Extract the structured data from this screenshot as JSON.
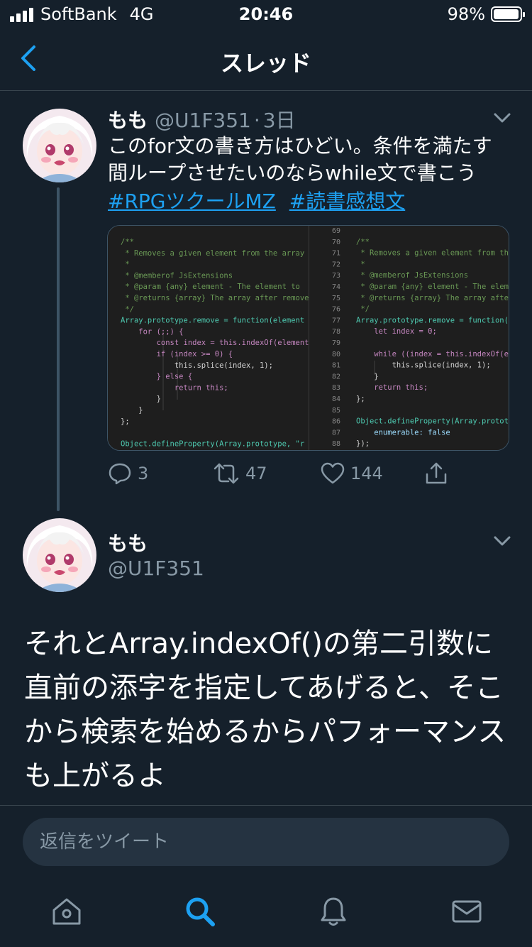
{
  "status_bar": {
    "carrier": "SoftBank",
    "network": "4G",
    "time": "20:46",
    "battery": "98%",
    "battery_level": 0.98
  },
  "nav": {
    "title": "スレッド",
    "back_icon": "chevron-left-icon"
  },
  "tweet1": {
    "name": "もも",
    "handle": "@U1F351",
    "dot": "·",
    "time": "3日",
    "text": "このfor文の書き方はひどい。条件を満たす間ループさせたいのならwhile文で書こう",
    "hashtags": [
      "#RPGツクールMZ",
      "#読書感想文"
    ],
    "replies": "3",
    "retweets": "47",
    "likes": "144"
  },
  "code_left": [
    {
      "ln": "",
      "text": "/**"
    },
    {
      "ln": "",
      "text": " * Removes a given element from the array"
    },
    {
      "ln": "",
      "text": " *"
    },
    {
      "ln": "",
      "text": " * @memberof JsExtensions"
    },
    {
      "ln": "",
      "text": " * @param {any} element - The element to"
    },
    {
      "ln": "",
      "text": " * @returns {array} The array after remove"
    },
    {
      "ln": "",
      "text": " */"
    },
    {
      "ln": "",
      "text": "Array.prototype.remove = function(element"
    },
    {
      "ln": "",
      "text": "    for (;;) {"
    },
    {
      "ln": "",
      "text": "        const index = this.indexOf(element"
    },
    {
      "ln": "",
      "text": "        if (index >= 0) {"
    },
    {
      "ln": "",
      "text": "            this.splice(index, 1);"
    },
    {
      "ln": "",
      "text": "        } else {"
    },
    {
      "ln": "",
      "text": "            return this;"
    },
    {
      "ln": "",
      "text": "        }"
    },
    {
      "ln": "",
      "text": "    }"
    },
    {
      "ln": "",
      "text": "};"
    },
    {
      "ln": "",
      "text": ""
    },
    {
      "ln": "",
      "text": "Object.defineProperty(Array.prototype, \"r"
    }
  ],
  "code_right": [
    {
      "ln": "69",
      "text": ""
    },
    {
      "ln": "70",
      "text": "/**"
    },
    {
      "ln": "71",
      "text": " * Removes a given element from th"
    },
    {
      "ln": "72",
      "text": " *"
    },
    {
      "ln": "73",
      "text": " * @memberof JsExtensions"
    },
    {
      "ln": "74",
      "text": " * @param {any} element - The elem"
    },
    {
      "ln": "75",
      "text": " * @returns {array} The array afte"
    },
    {
      "ln": "76",
      "text": " */"
    },
    {
      "ln": "77",
      "text": "Array.prototype.remove = function("
    },
    {
      "ln": "78",
      "text": "    let index = 0;"
    },
    {
      "ln": "79",
      "text": ""
    },
    {
      "ln": "80",
      "text": "    while ((index = this.indexOf(e"
    },
    {
      "ln": "81",
      "text": "        this.splice(index, 1);"
    },
    {
      "ln": "82",
      "text": "    }"
    },
    {
      "ln": "83",
      "text": "    return this;"
    },
    {
      "ln": "84",
      "text": "};"
    },
    {
      "ln": "85",
      "text": ""
    },
    {
      "ln": "86",
      "text": "Object.defineProperty(Array.protot"
    },
    {
      "ln": "87",
      "text": "    enumerable: false"
    },
    {
      "ln": "88",
      "text": "});"
    }
  ],
  "tweet2": {
    "name": "もも",
    "handle": "@U1F351",
    "text": "それとArray.indexOf()の第二引数に直前の添字を指定してあげると、そこから検索を始めるからパフォーマンスも上がるよ"
  },
  "reply": {
    "placeholder": "返信をツイート"
  },
  "tabs": [
    "home-icon",
    "search-icon",
    "notifications-icon",
    "messages-icon"
  ],
  "colors": {
    "background": "#15202b",
    "accent": "#1da1f2",
    "secondary_text": "#8899a6",
    "divider": "#38444d"
  }
}
